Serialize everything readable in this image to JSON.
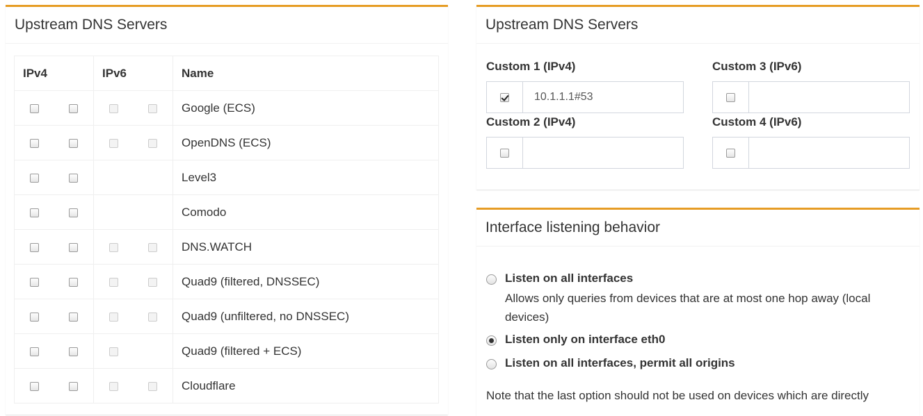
{
  "left_box": {
    "title": "Upstream DNS Servers",
    "columns": {
      "ipv4": "IPv4",
      "ipv6": "IPv6",
      "name": "Name"
    },
    "rows": [
      {
        "name": "Google (ECS)",
        "ipv4": [
          false,
          false
        ],
        "ipv6": [
          false,
          false
        ],
        "has_ipv6": true
      },
      {
        "name": "OpenDNS (ECS)",
        "ipv4": [
          false,
          false
        ],
        "ipv6": [
          false,
          false
        ],
        "has_ipv6": true
      },
      {
        "name": "Level3",
        "ipv4": [
          false,
          false
        ],
        "ipv6": [],
        "has_ipv6": false
      },
      {
        "name": "Comodo",
        "ipv4": [
          false,
          false
        ],
        "ipv6": [],
        "has_ipv6": false
      },
      {
        "name": "DNS.WATCH",
        "ipv4": [
          false,
          false
        ],
        "ipv6": [
          false,
          false
        ],
        "has_ipv6": true
      },
      {
        "name": "Quad9 (filtered, DNSSEC)",
        "ipv4": [
          false,
          false
        ],
        "ipv6": [
          false,
          false
        ],
        "has_ipv6": true
      },
      {
        "name": "Quad9 (unfiltered, no DNSSEC)",
        "ipv4": [
          false,
          false
        ],
        "ipv6": [
          false,
          false
        ],
        "has_ipv6": true
      },
      {
        "name": "Quad9 (filtered + ECS)",
        "ipv4": [
          false,
          false
        ],
        "ipv6": [
          false
        ],
        "has_ipv6": true
      },
      {
        "name": "Cloudflare",
        "ipv4": [
          false,
          false
        ],
        "ipv6": [
          false,
          false
        ],
        "has_ipv6": true
      }
    ]
  },
  "right_top_box": {
    "title": "Upstream DNS Servers",
    "custom": [
      {
        "label": "Custom 1 (IPv4)",
        "checked": true,
        "value": "10.1.1.1#53"
      },
      {
        "label": "Custom 2 (IPv4)",
        "checked": false,
        "value": ""
      },
      {
        "label": "Custom 3 (IPv6)",
        "checked": false,
        "value": ""
      },
      {
        "label": "Custom 4 (IPv6)",
        "checked": false,
        "value": ""
      }
    ]
  },
  "right_bottom_box": {
    "title": "Interface listening behavior",
    "options": [
      {
        "label": "Listen on all interfaces",
        "selected": false,
        "description": "Allows only queries from devices that are at most one hop away (local devices)"
      },
      {
        "label": "Listen only on interface eth0",
        "selected": true
      },
      {
        "label": "Listen on all interfaces, permit all origins",
        "selected": false
      }
    ],
    "note": "Note that the last option should not be used on devices which are directly"
  },
  "colors": {
    "accent": "#e69c24"
  }
}
